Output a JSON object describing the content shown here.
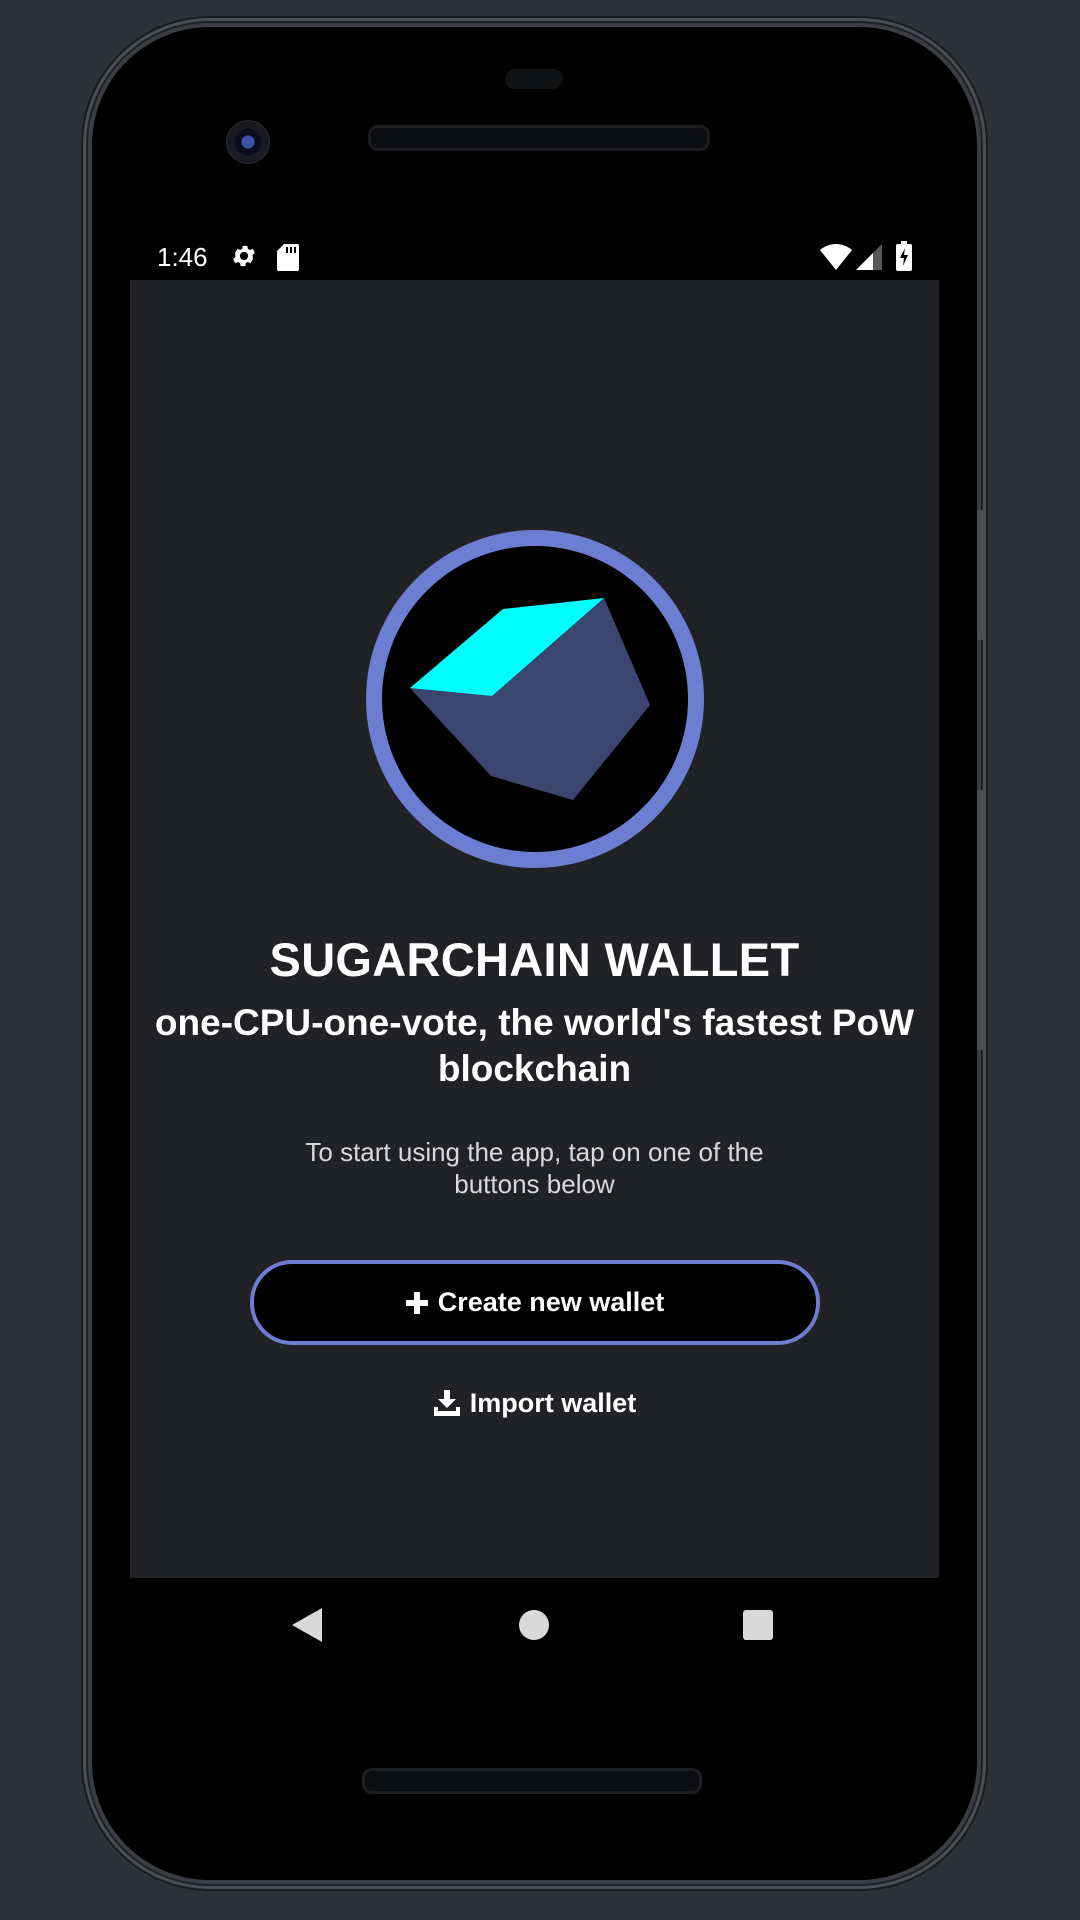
{
  "status_bar": {
    "time": "1:46",
    "icons": [
      "gear-icon",
      "sd-card-icon",
      "wifi-icon",
      "cell-signal-icon",
      "battery-charging-icon"
    ]
  },
  "app": {
    "logo": "sugarchain-cube-logo",
    "title": "SUGARCHAIN WALLET",
    "subtitle": "one-CPU-one-vote, the world's fastest PoW blockchain",
    "hint": "To start using the app, tap on one of the buttons below",
    "create_button": {
      "icon": "plus-icon",
      "label": "Create new wallet"
    },
    "import_button": {
      "icon": "download-icon",
      "label": "Import wallet"
    }
  },
  "navigation": {
    "icons": [
      "back-icon",
      "home-icon",
      "recents-icon"
    ]
  },
  "colors": {
    "accent": "#6b7ed1",
    "cube_top": "#00ffff",
    "cube_side": "#3a4670",
    "screen_bg": "#212226"
  }
}
